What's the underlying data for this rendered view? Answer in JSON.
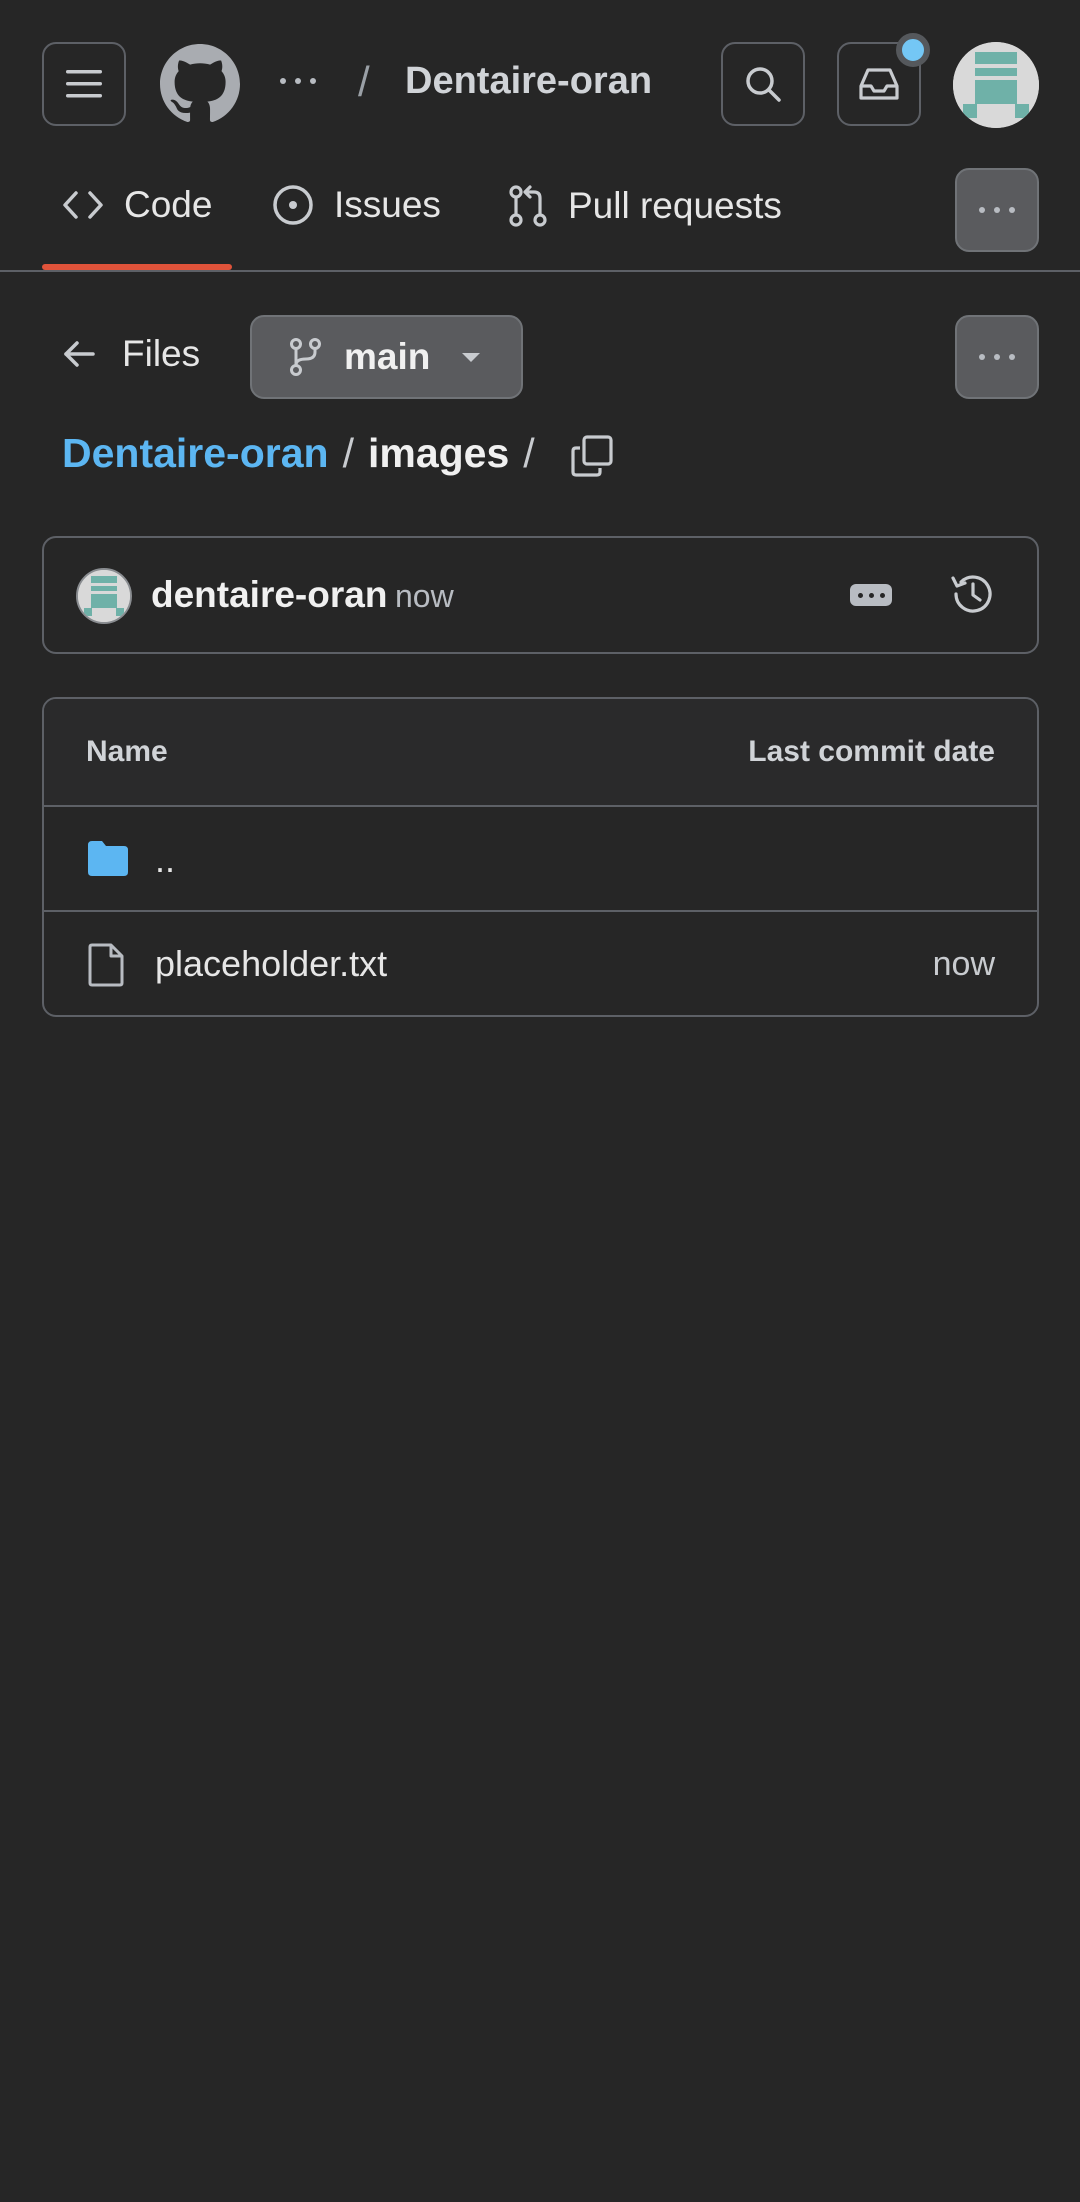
{
  "header": {
    "repo_name": "Dentaire-oran",
    "separator": "/"
  },
  "tabs": [
    {
      "label": "Code",
      "icon": "code-icon",
      "active": true
    },
    {
      "label": "Issues",
      "icon": "issue-opened-icon",
      "active": false
    },
    {
      "label": "Pull requests",
      "icon": "git-pull-request-icon",
      "active": false
    }
  ],
  "files_nav": {
    "back_label": "Files",
    "branch": "main"
  },
  "breadcrumb": {
    "repo": "Dentaire-oran",
    "directory": "images",
    "separator": "/"
  },
  "latest_commit": {
    "author": "dentaire-oran",
    "time": "now"
  },
  "file_table": {
    "columns": [
      "Name",
      "Last commit date"
    ],
    "rows": [
      {
        "name": "..",
        "type": "parent-directory",
        "date": ""
      },
      {
        "name": "placeholder.txt",
        "type": "file",
        "date": "now"
      }
    ]
  },
  "colors": {
    "background": "#262626",
    "accent_link": "#5cb6f2",
    "active_tab_underline": "#e0533a",
    "notification_dot": "#74c7f5",
    "folder": "#5cb6f2"
  }
}
